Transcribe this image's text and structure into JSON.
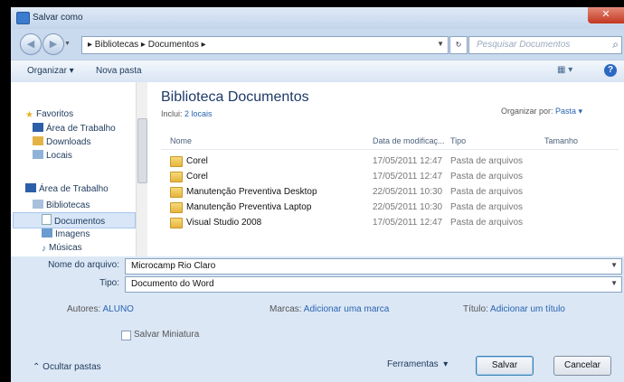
{
  "window": {
    "title": "Salvar como",
    "close_glyph": "✕"
  },
  "nav": {
    "address_path": "▸ Bibliotecas ▸ Documentos ▸",
    "search_placeholder": "Pesquisar Documentos"
  },
  "toolbar": {
    "organize_label": "Organizar ▾",
    "new_folder_label": "Nova pasta"
  },
  "sidebar": {
    "items": [
      {
        "label": "Favoritos",
        "icon": "star-icon"
      },
      {
        "label": "Área de Trabalho",
        "icon": "desktop-icon"
      },
      {
        "label": "Downloads",
        "icon": "downloads-icon"
      },
      {
        "label": "Locais",
        "icon": "recent-places-icon"
      },
      {
        "label": "Área de Trabalho",
        "icon": "desktop-icon"
      },
      {
        "label": "Bibliotecas",
        "icon": "library-icon"
      },
      {
        "label": "Documentos",
        "icon": "documents-icon"
      },
      {
        "label": "Imagens",
        "icon": "pictures-icon"
      },
      {
        "label": "Músicas",
        "icon": "music-icon"
      }
    ]
  },
  "library": {
    "title": "Biblioteca Documentos",
    "includes_label": "Inclui:",
    "includes_link": "2 locais",
    "arrange_label": "Organizar por:",
    "arrange_value": "Pasta ▾",
    "columns": [
      "Nome",
      "Data de modificaç...",
      "Tipo",
      "Tamanho"
    ],
    "rows": [
      {
        "name": "Corel",
        "date": "17/05/2011 12:47",
        "type": "Pasta de arquivos"
      },
      {
        "name": "Corel",
        "date": "17/05/2011 12:47",
        "type": "Pasta de arquivos"
      },
      {
        "name": "Manutenção Preventiva Desktop",
        "date": "22/05/2011 10:30",
        "type": "Pasta de arquivos"
      },
      {
        "name": "Manutenção Preventiva Laptop",
        "date": "22/05/2011 10:30",
        "type": "Pasta de arquivos"
      },
      {
        "name": "Visual Studio 2008",
        "date": "17/05/2011 12:47",
        "type": "Pasta de arquivos"
      }
    ]
  },
  "form": {
    "filename_label": "Nome do arquivo:",
    "filename_value": "Microcamp Rio Claro",
    "type_label": "Tipo:",
    "type_value": "Documento do Word",
    "authors_label": "Autores:",
    "authors_value": "ALUNO",
    "tags_label": "Marcas:",
    "tags_value": "Adicionar uma marca",
    "title_label": "Título:",
    "title_value": "Adicionar um título",
    "thumbnail_label": "Salvar Miniatura",
    "hide_folders_label": "Ocultar pastas",
    "tools_label": "Ferramentas",
    "save_label": "Salvar",
    "cancel_label": "Cancelar"
  },
  "colors": {
    "accent": "#2b68c4",
    "window_bg": "#c9d9ee",
    "form_bg": "#dbe7f5"
  }
}
